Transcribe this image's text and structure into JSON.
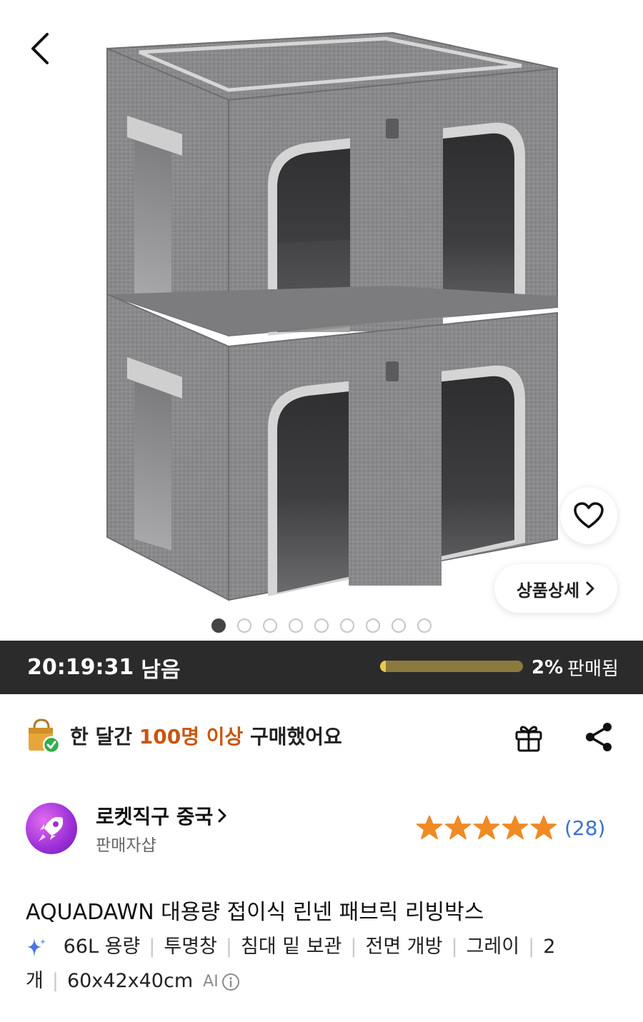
{
  "header": {
    "back_icon": "chevron-left-icon"
  },
  "gallery": {
    "image_alt": "Product image",
    "total_images": 9,
    "active_index": 0,
    "wishlist_icon": "heart-icon",
    "detail_label": "상품상세"
  },
  "timer": {
    "time": "20:19:31",
    "suffix": "남음",
    "progress_percent": 2,
    "progress_label": "2%",
    "progress_suffix": "판매됨"
  },
  "purchase": {
    "prefix": "한 달간",
    "highlight": "100명 이상",
    "suffix": "구매했어요"
  },
  "actions": {
    "gift_icon": "gift-icon",
    "share_icon": "share-icon"
  },
  "seller": {
    "name": "로켓직구 중국",
    "subtitle": "판매자샵",
    "rating_stars": 5,
    "review_count": "(28)"
  },
  "product": {
    "title": "AQUADAWN 대용량 접이식 린넨 패브릭 리빙박스",
    "tags": [
      "66L 용량",
      "투명창",
      "침대 밑 보관",
      "전면 개방",
      "그레이",
      "2개",
      "60x42x40cm"
    ],
    "ai_label": "AI"
  },
  "colors": {
    "highlight": "#c8560f",
    "timer_bg": "#2b2b2b",
    "progress": "#e9c94b",
    "star": "#f08a24",
    "review": "#3d6fd1"
  }
}
